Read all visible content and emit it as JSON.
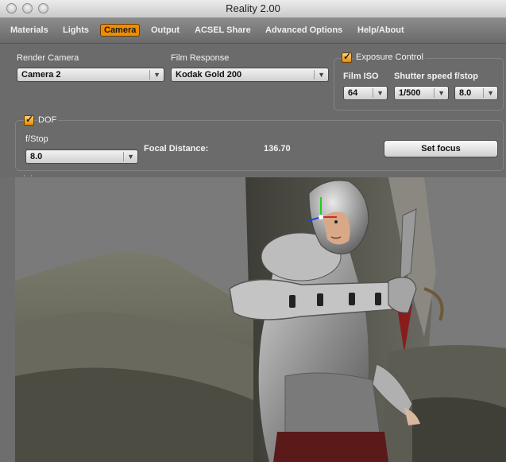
{
  "window": {
    "title": "Reality  2.00"
  },
  "tabs": [
    {
      "label": "Materials"
    },
    {
      "label": "Lights"
    },
    {
      "label": "Camera"
    },
    {
      "label": "Output"
    },
    {
      "label": "ACSEL Share"
    },
    {
      "label": "Advanced Options"
    },
    {
      "label": "Help/About"
    }
  ],
  "render_camera": {
    "label": "Render Camera",
    "value": "Camera 2"
  },
  "film_response": {
    "label": "Film Response",
    "value": "Kodak Gold 200"
  },
  "exposure": {
    "title": "Exposure Control",
    "checked": true,
    "film_iso": {
      "label": "Film ISO",
      "value": "64"
    },
    "shutter_speed": {
      "label": "Shutter speed",
      "value": "1/500"
    },
    "fstop": {
      "label": "f/stop",
      "value": "8.0"
    }
  },
  "dof": {
    "title": "DOF",
    "checked": true,
    "fstop": {
      "label": "f/Stop",
      "value": "8.0"
    },
    "focal_distance": {
      "label": "Focal Distance:",
      "value": "136.70"
    },
    "set_focus_label": "Set focus"
  },
  "viewport": {
    "scene": "armored-warrior-render"
  },
  "colors": {
    "accent": "#f08c00",
    "panel": "#6b6b6b",
    "text": "#f2f2f2"
  }
}
